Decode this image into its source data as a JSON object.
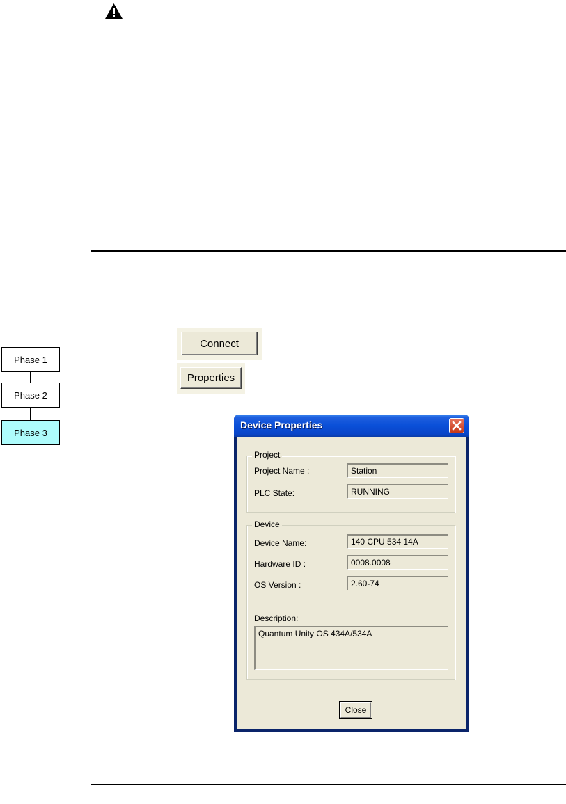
{
  "phases": [
    "Phase 1",
    "Phase 2",
    "Phase 3"
  ],
  "buttons": {
    "connect": "Connect",
    "properties": "Properties"
  },
  "dialog": {
    "title": "Device Properties",
    "project": {
      "legend": "Project",
      "name_label": "Project Name :",
      "name_value": "Station",
      "state_label": "PLC State:",
      "state_value": "RUNNING"
    },
    "device": {
      "legend": "Device",
      "name_label": "Device Name:",
      "name_value": "140 CPU 534 14A",
      "hwid_label": "Hardware ID :",
      "hwid_value": "0008.0008",
      "os_label": "OS Version :",
      "os_value": "2.60-74",
      "desc_label": "Description:",
      "desc_value": "Quantum Unity OS 434A/534A"
    },
    "close_label": "Close"
  },
  "colors": {
    "active_phase": "#aefcfc",
    "title_bar": "#0a4fd8",
    "dialog_bg": "#ece9d8"
  }
}
